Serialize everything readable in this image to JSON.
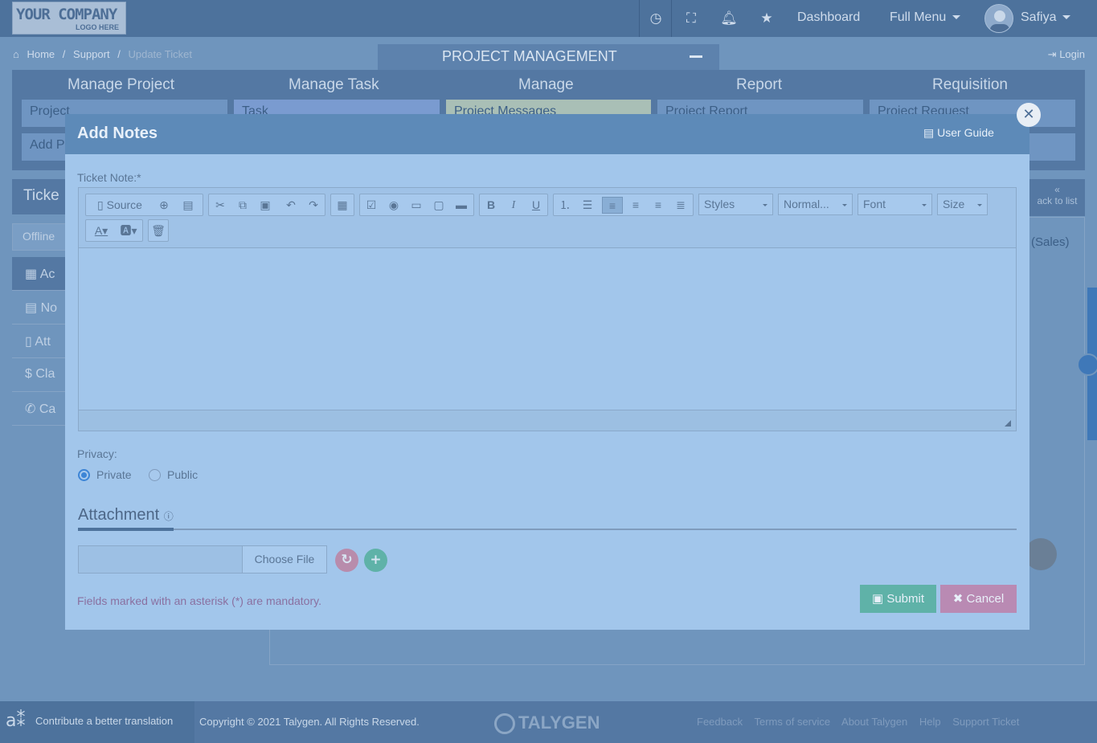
{
  "topbar": {
    "logo_line1": "YOUR COMPANY",
    "logo_line2": "LOGO HERE",
    "dashboard": "Dashboard",
    "full_menu": "Full Menu",
    "user_name": "Safiya"
  },
  "breadcrumb": {
    "home": "Home",
    "sep1": "/",
    "support": "Support",
    "sep2": "/",
    "current": "Update Ticket"
  },
  "login": "Login",
  "module_title": "PROJECT MANAGEMENT",
  "menu": {
    "columns": [
      "Manage Project",
      "Manage Task",
      "Manage",
      "Report",
      "Requisition"
    ],
    "row1": [
      "Project",
      "Task",
      "Project Messages",
      "Project Report",
      "Project Request"
    ],
    "row2": [
      "Add P"
    ]
  },
  "left": {
    "header": "Ticke",
    "status": "Offline",
    "nav": [
      "Ac",
      "No",
      "Att",
      "Cla",
      "Ca"
    ]
  },
  "right": {
    "back_to_list": "ack to list",
    "sales": "(Sales)"
  },
  "footer": {
    "contribute": "Contribute a better translation",
    "copyright": "Copyright © 2021 Talygen. All Rights Reserved.",
    "brand": "TALYGEN",
    "links": [
      "Feedback",
      "Terms of service",
      "About Talygen",
      "Help",
      "Support Ticket"
    ]
  },
  "modal": {
    "title": "Add Notes",
    "user_guide": "User Guide",
    "ticket_note_label": "Ticket Note:*",
    "toolbar": {
      "source": "Source",
      "styles": "Styles",
      "format": "Normal...",
      "font": "Font",
      "size": "Size"
    },
    "privacy_label": "Privacy:",
    "privacy_options": [
      "Private",
      "Public"
    ],
    "privacy_selected": "Private",
    "attachment_title": "Attachment",
    "choose_file": "Choose File",
    "mandatory_note": "Fields marked with an asterisk (*) are mandatory.",
    "submit": "Submit",
    "cancel": "Cancel"
  },
  "colors": {
    "submit": "#5fb2a8",
    "cancel": "#b98ab3",
    "primary_radio": "#3d85d6"
  }
}
